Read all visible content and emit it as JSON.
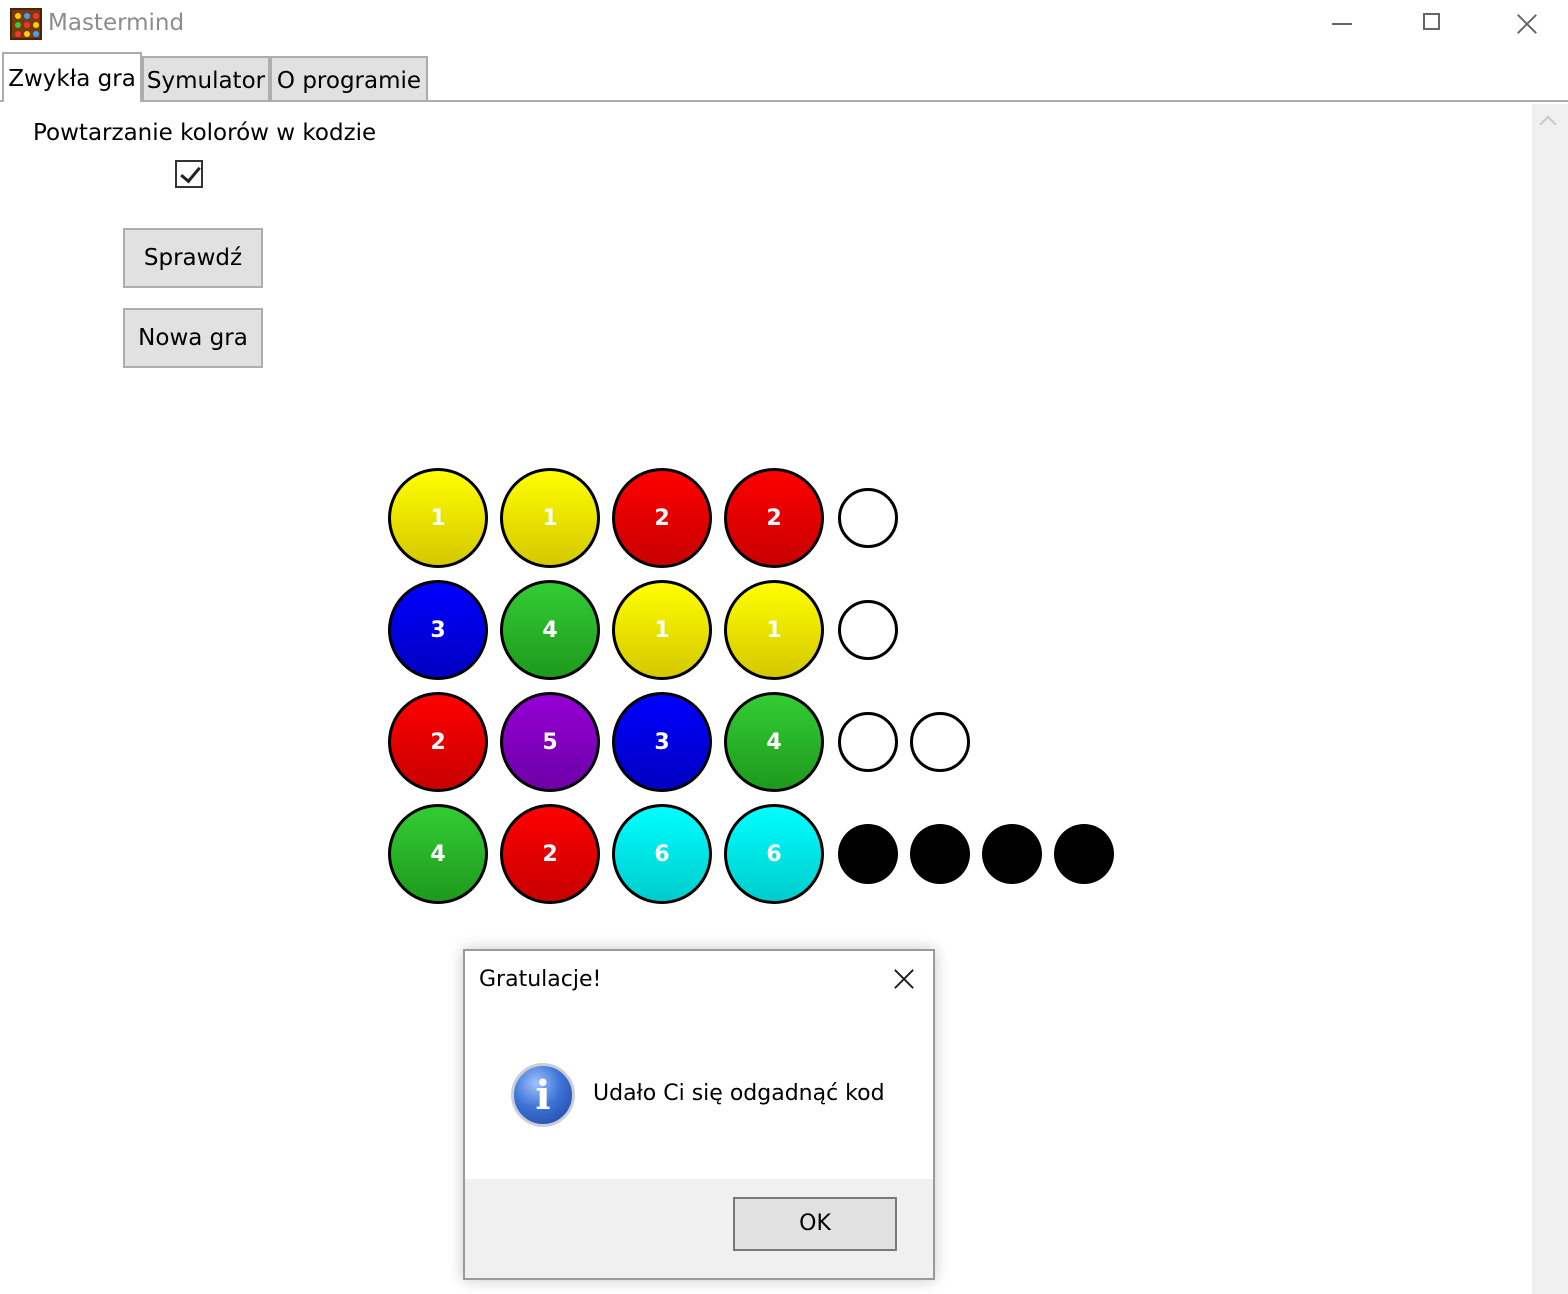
{
  "window": {
    "title": "Mastermind"
  },
  "tabs": [
    {
      "label": "Zwykła gra",
      "active": true
    },
    {
      "label": "Symulator",
      "active": false
    },
    {
      "label": "O programie",
      "active": false
    }
  ],
  "settings": {
    "repeat_colors_label": "Powtarzanie kolorów w kodzie",
    "repeat_colors_checked": true
  },
  "buttons": {
    "check_label": "Sprawdź",
    "new_game_label": "Nowa gra"
  },
  "colors": {
    "yellow": "#ffff00",
    "red": "#ff0000",
    "blue": "#0000ff",
    "green": "#33cc33",
    "purple": "#9400d3",
    "cyan": "#00ffff"
  },
  "board": {
    "rows": [
      {
        "pegs": [
          {
            "number": "1",
            "color": "yellow"
          },
          {
            "number": "1",
            "color": "yellow"
          },
          {
            "number": "2",
            "color": "red"
          },
          {
            "number": "2",
            "color": "red"
          }
        ],
        "hints": [
          "white"
        ]
      },
      {
        "pegs": [
          {
            "number": "3",
            "color": "blue"
          },
          {
            "number": "4",
            "color": "green"
          },
          {
            "number": "1",
            "color": "yellow"
          },
          {
            "number": "1",
            "color": "yellow"
          }
        ],
        "hints": [
          "white"
        ]
      },
      {
        "pegs": [
          {
            "number": "2",
            "color": "red"
          },
          {
            "number": "5",
            "color": "purple"
          },
          {
            "number": "3",
            "color": "blue"
          },
          {
            "number": "4",
            "color": "green"
          }
        ],
        "hints": [
          "white",
          "white"
        ]
      },
      {
        "pegs": [
          {
            "number": "4",
            "color": "green"
          },
          {
            "number": "2",
            "color": "red"
          },
          {
            "number": "6",
            "color": "cyan"
          },
          {
            "number": "6",
            "color": "cyan"
          }
        ],
        "hints": [
          "black",
          "black",
          "black",
          "black"
        ]
      }
    ]
  },
  "dialog": {
    "title": "Gratulacje!",
    "message": "Udało Ci się odgadnąć kod",
    "ok_label": "OK",
    "icon": "info-icon"
  }
}
